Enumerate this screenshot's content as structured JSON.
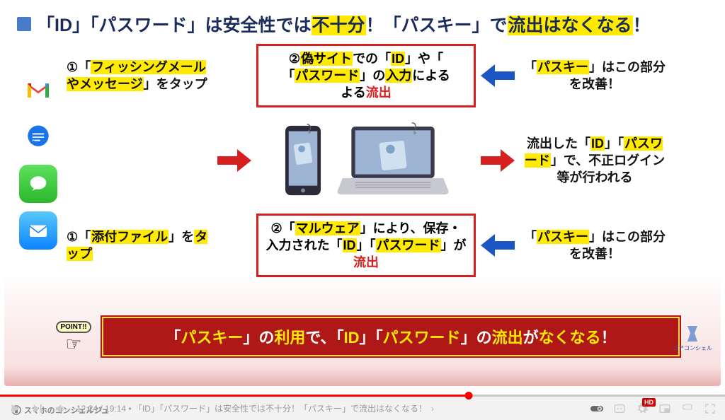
{
  "slide": {
    "title_parts": {
      "p1": "「ID」「パスワード」は安全性では",
      "p2": "不十分",
      "p3": "！「パスキー」で",
      "p4": "流出はなくなる",
      "p5": "！"
    },
    "col1": {
      "top": {
        "pre": "①「",
        "hl": "フィッシングメールやメッセージ",
        "post": "」をタップ"
      },
      "bottom": {
        "pre": "①「",
        "hl": "添付ファイル",
        "post": "」を",
        "hl2": "タップ"
      }
    },
    "middle_top": {
      "p1": "②",
      "hl1": "偽サイト",
      "p2": "での「",
      "hl2": "ID",
      "p3": "」や「",
      "hl3": "パスワード",
      "p4": "」の",
      "hl4": "入力",
      "p5": "による",
      "r": "流出"
    },
    "middle_bottom": {
      "p1": "②「",
      "hl1": "マルウェア",
      "p2": "」により、",
      "b1": "保存・入力",
      "p3": "された「",
      "hl2": "ID",
      "p4": "」「",
      "hl3": "パスワード",
      "p5": "」が",
      "r": "流出"
    },
    "right_top": {
      "p1": "「",
      "hl": "パスキー",
      "p2": "」はこの部分を改善！"
    },
    "right_mid": {
      "p1": "流出した「",
      "hl1": "ID",
      "p2": "」「",
      "hl2": "パスワード",
      "p3": "」で、",
      "b": "不正ログイン",
      "p4": "等が行われる"
    },
    "right_bottom": {
      "p1": "「",
      "hl": "パスキー",
      "p2": "」はこの部分を改善！"
    },
    "banner": {
      "p1": "「",
      "y1": "パスキー",
      "p2": "」の",
      "y2": "利用",
      "p3": "で、「",
      "y3": "ID",
      "p4": "」「",
      "y4": "パスワード",
      "p5": "」の",
      "y5": "流出",
      "p6": "が",
      "y6": "なくなる",
      "p7": "！"
    },
    "point": "POINT!!",
    "corner": "コアコンシェル"
  },
  "player": {
    "time_current": "12:24",
    "time_total": "19:14",
    "sep": " / ",
    "bullet": " • ",
    "title": "「ID」「パスワード」は安全性では不十分！「パスキー」で流出はなくなる！",
    "hd": "HD"
  },
  "watermark": "スマホのコンシェルジュ"
}
